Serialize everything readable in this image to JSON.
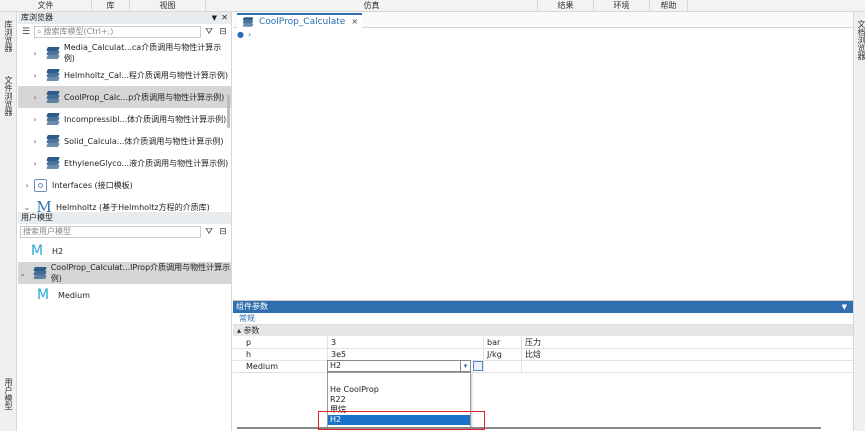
{
  "menu": [
    "文件",
    "库",
    "视图",
    "仿真",
    "结果",
    "环境",
    "帮助"
  ],
  "left_strip": {
    "tab1": "库浏览器",
    "tab2": "文件浏览器",
    "tab3": "用户模型"
  },
  "right_strip": {
    "tab1": "文档浏览器"
  },
  "library": {
    "title": "库浏览器",
    "search_placeholder": "搜索库模型(Ctrl+;)",
    "items": [
      {
        "label": "Media_Calculat...ca介质调用与物性计算示例)",
        "icon": "package-stack-icon"
      },
      {
        "label": "Helmholtz_Cal...程介质调用与物性计算示例)",
        "icon": "package-stack-icon"
      },
      {
        "label": "CoolProp_Calc...p介质调用与物性计算示例)",
        "icon": "package-stack-icon",
        "selected": true
      },
      {
        "label": "Incompressibl...体介质调用与物性计算示例)",
        "icon": "package-stack-icon"
      },
      {
        "label": "Solid_Calcula...体介质调用与物性计算示例)",
        "icon": "package-stack-icon"
      },
      {
        "label": "EthyleneGlyco...液介质调用与物性计算示例)",
        "icon": "package-stack-icon"
      },
      {
        "label": "Interfaces (接口模板)",
        "icon": "interface-icon"
      },
      {
        "label": "Helmholtz (基于Helmholtz方程的介质库)",
        "icon": "model-M-icon"
      }
    ]
  },
  "user_models": {
    "title": "用户模型",
    "search_placeholder": "搜索用户模型",
    "items": [
      {
        "label": "H2",
        "icon": "model-M-icon"
      },
      {
        "label": "CoolProp_Calculat...lProp介质调用与物性计算示例)",
        "icon": "package-stack-icon",
        "selected": true
      },
      {
        "label": "Medium",
        "icon": "model-M-icon"
      }
    ]
  },
  "editor": {
    "tab_label": "CoolProp_Calculate",
    "tab_close": "×"
  },
  "component_params": {
    "title": "组件参数",
    "subtab": "常规",
    "group": "参数",
    "rows": [
      {
        "name": "p",
        "value": "3",
        "unit": "bar",
        "desc": "压力"
      },
      {
        "name": "h",
        "value": "3e5",
        "unit": "J/kg",
        "desc": "比焓"
      },
      {
        "name": "Medium",
        "value": "H2",
        "unit": "",
        "desc": ""
      }
    ],
    "dropdown_options": [
      "",
      "He CoolProp",
      "R22",
      "甲烷",
      "H2"
    ],
    "dropdown_selected": "H2"
  },
  "colors": {
    "accent": "#2f6fb0",
    "selection": "#1a73c9",
    "highlight_box": "#e0202a"
  }
}
